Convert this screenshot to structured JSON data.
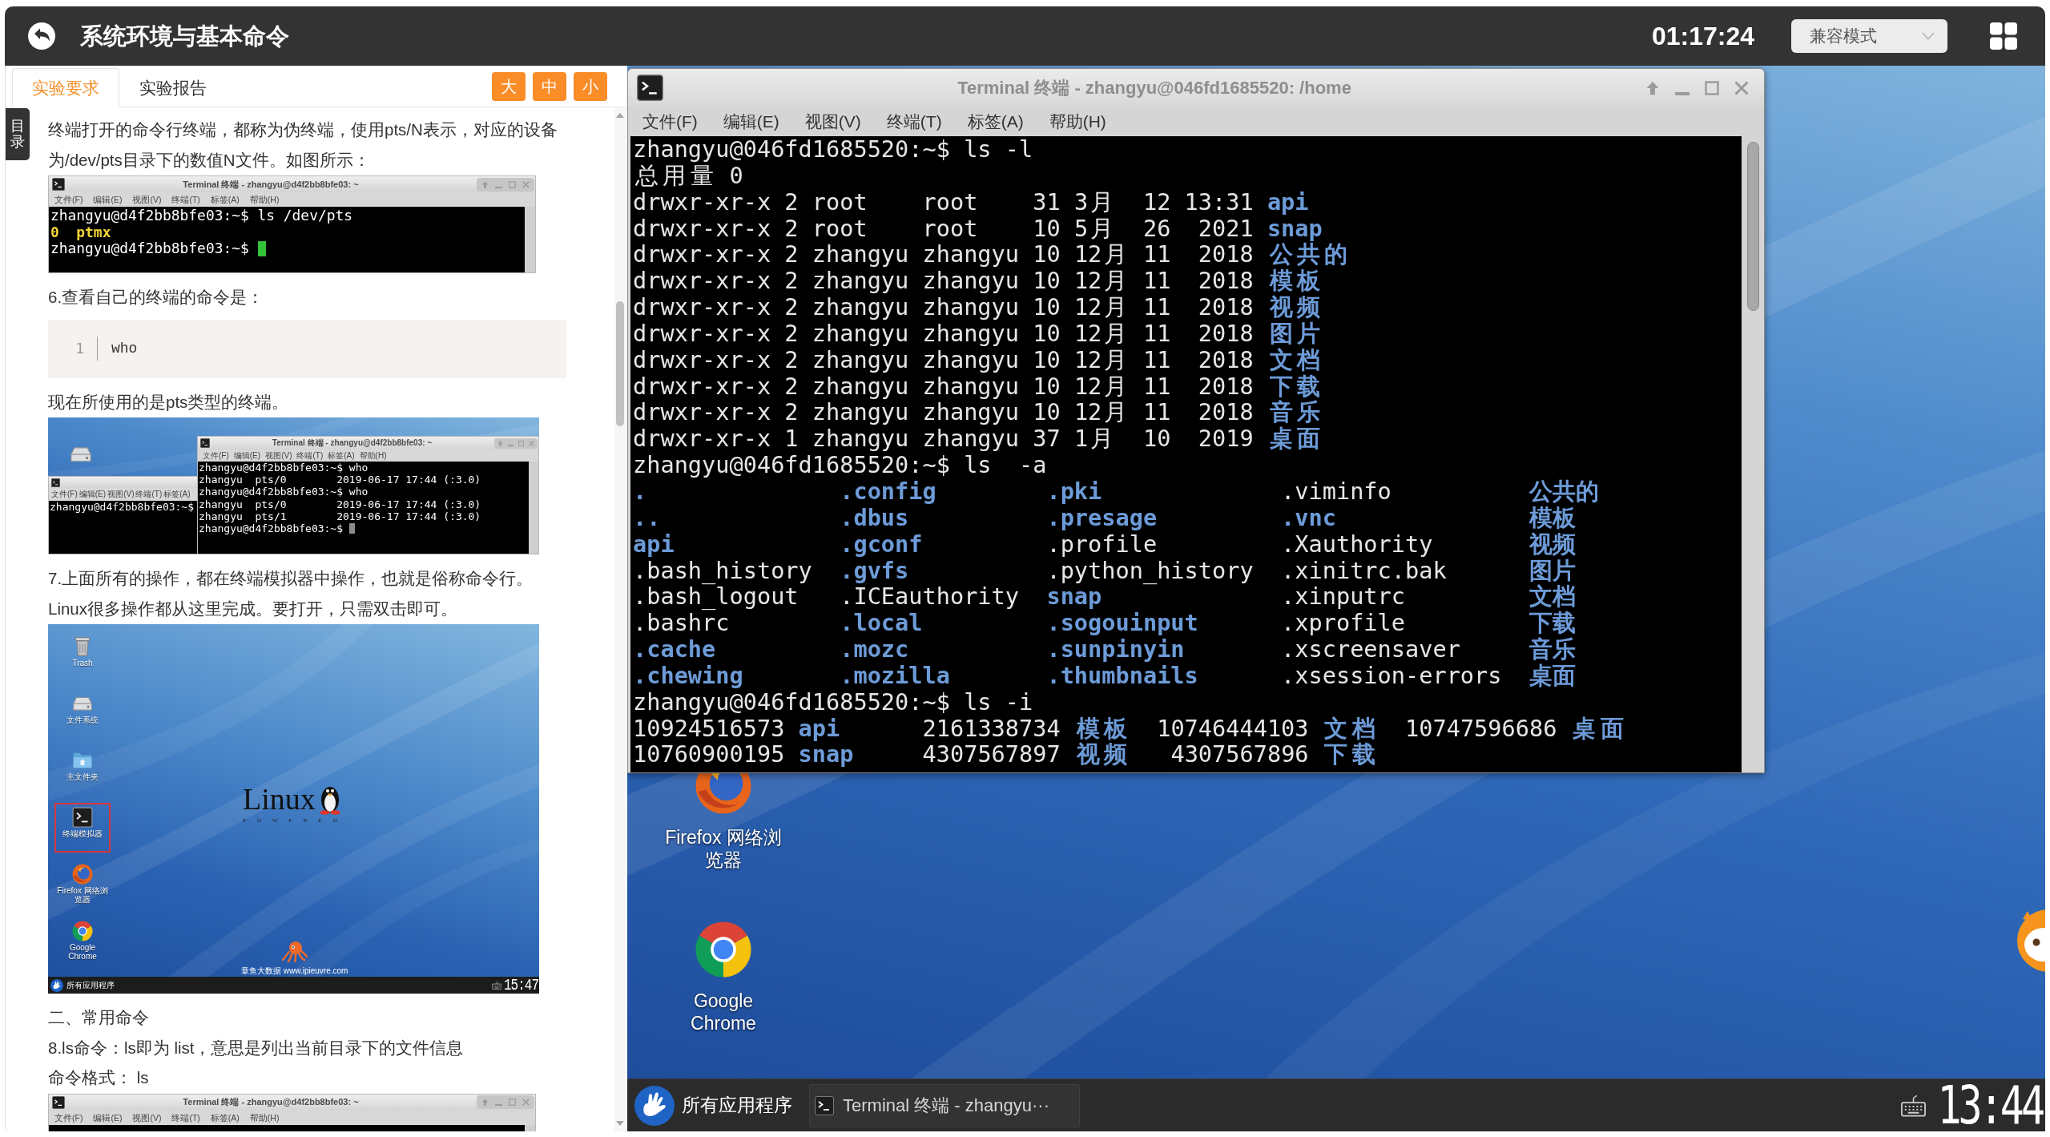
{
  "header": {
    "title": "系统环境与基本命令",
    "timer": "01:17:24",
    "mode_select": {
      "value": "兼容模式"
    }
  },
  "doc_panel": {
    "tabs": [
      {
        "label": "实验要求",
        "selected": true
      },
      {
        "label": "实验报告",
        "selected": false
      }
    ],
    "font_size_buttons": [
      "大",
      "中",
      "小"
    ],
    "toc_tab": "目录",
    "content": [
      {
        "kind": "paragraph",
        "text": "终端打开的命令行终端，都称为伪终端，使用pts/N表示，对应的设备为/dev/pts目录下的数值N文件。如图所示："
      },
      {
        "kind": "terminal_image",
        "window": {
          "title": "Terminal 终端 - zhangyu@d4f2bb8bfe03: ~",
          "menu": [
            "文件(F)",
            "编辑(E)",
            "视图(V)",
            "终端(T)",
            "标签(A)",
            "帮助(H)"
          ],
          "lines": [
            {
              "kind": "text",
              "text": "zhangyu@d4f2bb8bfe03:~$ ls /dev/pts"
            },
            {
              "kind": "highlight",
              "text": "0  ptmx"
            },
            {
              "kind": "text",
              "text": "zhangyu@d4f2bb8bfe03:~$ ",
              "cursor": true,
              "cursor_active": true
            }
          ]
        }
      },
      {
        "kind": "paragraph",
        "text": "6.查看自己的终端的命令是："
      },
      {
        "kind": "code",
        "lines": [
          {
            "number": "1",
            "code": "who"
          }
        ]
      },
      {
        "kind": "paragraph",
        "text": "现在所使用的是pts类型的终端。"
      },
      {
        "kind": "two_terminals_image",
        "back_window": {
          "menu": [
            "文件(F)",
            "编辑(E)",
            "视图(V)",
            "终端(T)",
            "标签(A)"
          ],
          "lines": [
            {
              "kind": "text",
              "text": "zhangyu@d4f2bb8bfe03:~$"
            }
          ]
        },
        "front_window": {
          "title": "Terminal 终端 - zhangyu@d4f2bb8bfe03: ~",
          "menu": [
            "文件(F)",
            "编辑(E)",
            "视图(V)",
            "终端(T)",
            "标签(A)",
            "帮助(H)"
          ],
          "lines": [
            {
              "kind": "text",
              "text": "zhangyu@d4f2bb8bfe03:~$ who"
            },
            {
              "kind": "text",
              "text": "zhangyu  pts/0        2019-06-17 17:44 (:3.0)"
            },
            {
              "kind": "text",
              "text": "zhangyu@d4f2bb8bfe03:~$ who"
            },
            {
              "kind": "text",
              "text": "zhangyu  pts/0        2019-06-17 17:44 (:3.0)"
            },
            {
              "kind": "text",
              "text": "zhangyu  pts/1        2019-06-17 17:44 (:3.0)"
            },
            {
              "kind": "text",
              "text": "zhangyu@d4f2bb8bfe03:~$ ",
              "cursor": true,
              "cursor_active": false
            }
          ]
        }
      },
      {
        "kind": "paragraph",
        "text": "7.上面所有的操作，都在终端模拟器中操作，也就是俗称命令行。Linux很多操作都从这里完成。要打开，只需双击即可。"
      },
      {
        "kind": "desktop_image",
        "icons": [
          {
            "kind": "trash",
            "label": "Trash",
            "highlighted": false
          },
          {
            "kind": "drive",
            "label": "文件系统",
            "highlighted": false
          },
          {
            "kind": "folder",
            "label": "主文件夹",
            "highlighted": false
          },
          {
            "kind": "terminal",
            "label": "终端模拟器",
            "highlighted": true
          },
          {
            "kind": "firefox",
            "label": "Firefox 网络浏览器",
            "highlighted": false
          },
          {
            "kind": "chrome",
            "label": "Google Chrome",
            "highlighted": false
          }
        ],
        "logo": {
          "text": "Linux",
          "tagline": "POWERED"
        },
        "wallpaper_caption": "章鱼大数据 www.ipieuvre.com",
        "taskbar": {
          "menu_label": "所有应用程序",
          "clock": "15:47"
        }
      },
      {
        "kind": "paragraph",
        "text": "二、常用命令"
      },
      {
        "kind": "paragraph",
        "text": "8.ls命令：ls即为 list，意思是列出当前目录下的文件信息"
      },
      {
        "kind": "paragraph",
        "text": "命令格式： ls"
      },
      {
        "kind": "terminal_image",
        "window": {
          "title": "Terminal 终端 - zhangyu@d4f2bb8bfe03: ~",
          "menu": [
            "文件(F)",
            "编辑(E)",
            "视图(V)",
            "终端(T)",
            "标签(A)",
            "帮助(H)"
          ]
        }
      }
    ]
  },
  "desktop": {
    "terminal_window": {
      "title": "Terminal 终端 - zhangyu@046fd1685520: /home",
      "menu": [
        "文件(F)",
        "编辑(E)",
        "视图(V)",
        "终端(T)",
        "标签(A)",
        "帮助(H)"
      ],
      "lines": [
        {
          "kind": "text",
          "text": "zhangyu@046fd1685520:~$ ls -l"
        },
        {
          "kind": "text",
          "text": "总用量 0"
        },
        {
          "kind": "text",
          "text": "drwxr-xr-x 2 root    root    31 3月  12 13:31 **api**"
        },
        {
          "kind": "text",
          "text": "drwxr-xr-x 2 root    root    10 5月  26  2021 **snap**"
        },
        {
          "kind": "text",
          "text": "drwxr-xr-x 2 zhangyu zhangyu 10 12月 11  2018 **公共的**"
        },
        {
          "kind": "text",
          "text": "drwxr-xr-x 2 zhangyu zhangyu 10 12月 11  2018 **模板**"
        },
        {
          "kind": "text",
          "text": "drwxr-xr-x 2 zhangyu zhangyu 10 12月 11  2018 **视频**"
        },
        {
          "kind": "text",
          "text": "drwxr-xr-x 2 zhangyu zhangyu 10 12月 11  2018 **图片**"
        },
        {
          "kind": "text",
          "text": "drwxr-xr-x 2 zhangyu zhangyu 10 12月 11  2018 **文档**"
        },
        {
          "kind": "text",
          "text": "drwxr-xr-x 2 zhangyu zhangyu 10 12月 11  2018 **下载**"
        },
        {
          "kind": "text",
          "text": "drwxr-xr-x 2 zhangyu zhangyu 10 12月 11  2018 **音乐**"
        },
        {
          "kind": "text",
          "text": "drwxr-xr-x 1 zhangyu zhangyu 37 1月  10  2019 **桌面**"
        },
        {
          "kind": "text",
          "text": "zhangyu@046fd1685520:~$ ls  -a"
        },
        {
          "kind": "columns",
          "rows": [
            [
              {
                "text": ".",
                "kind": "dir"
              },
              {
                "text": ".config",
                "kind": "dir"
              },
              {
                "text": ".pki",
                "kind": "dir"
              },
              {
                "text": ".viminfo",
                "kind": "file"
              },
              {
                "text": "公共的",
                "kind": "dir"
              }
            ],
            [
              {
                "text": "..",
                "kind": "dir"
              },
              {
                "text": ".dbus",
                "kind": "dir"
              },
              {
                "text": ".presage",
                "kind": "dir"
              },
              {
                "text": ".vnc",
                "kind": "dir"
              },
              {
                "text": "模板",
                "kind": "dir"
              }
            ],
            [
              {
                "text": "api",
                "kind": "dir"
              },
              {
                "text": ".gconf",
                "kind": "dir"
              },
              {
                "text": ".profile",
                "kind": "file"
              },
              {
                "text": ".Xauthority",
                "kind": "file"
              },
              {
                "text": "视频",
                "kind": "dir"
              }
            ],
            [
              {
                "text": ".bash_history",
                "kind": "file"
              },
              {
                "text": ".gvfs",
                "kind": "dir"
              },
              {
                "text": ".python_history",
                "kind": "file"
              },
              {
                "text": ".xinitrc.bak",
                "kind": "file"
              },
              {
                "text": "图片",
                "kind": "dir"
              }
            ],
            [
              {
                "text": ".bash_logout",
                "kind": "file"
              },
              {
                "text": ".ICEauthority",
                "kind": "file"
              },
              {
                "text": "snap",
                "kind": "dir"
              },
              {
                "text": ".xinputrc",
                "kind": "file"
              },
              {
                "text": "文档",
                "kind": "dir"
              }
            ],
            [
              {
                "text": ".bashrc",
                "kind": "file"
              },
              {
                "text": ".local",
                "kind": "dir"
              },
              {
                "text": ".sogouinput",
                "kind": "dir"
              },
              {
                "text": ".xprofile",
                "kind": "file"
              },
              {
                "text": "下载",
                "kind": "dir"
              }
            ],
            [
              {
                "text": ".cache",
                "kind": "dir"
              },
              {
                "text": ".mozc",
                "kind": "dir"
              },
              {
                "text": ".sunpinyin",
                "kind": "dir"
              },
              {
                "text": ".xscreensaver",
                "kind": "file"
              },
              {
                "text": "音乐",
                "kind": "dir"
              }
            ],
            [
              {
                "text": ".chewing",
                "kind": "dir"
              },
              {
                "text": ".mozilla",
                "kind": "dir"
              },
              {
                "text": ".thumbnails",
                "kind": "dir"
              },
              {
                "text": ".xsession-errors",
                "kind": "file"
              },
              {
                "text": "桌面",
                "kind": "dir"
              }
            ]
          ]
        },
        {
          "kind": "text",
          "text": "zhangyu@046fd1685520:~$ ls -i"
        },
        {
          "kind": "text",
          "text": "10924516573 **api**      2161338734 **模板**  10746444103 **文档**  10747596686 **桌面**"
        },
        {
          "kind": "text",
          "text": "10760900195 **snap**     4307567897 **视频**   4307567896 **下载**"
        }
      ]
    },
    "icons": [
      {
        "kind": "firefox",
        "label": "Firefox 网络浏览器"
      },
      {
        "kind": "chrome",
        "label": "Google Chrome"
      }
    ],
    "taskbar": {
      "menu_label": "所有应用程序",
      "tasks": [
        {
          "label": "Terminal 终端 - zhangyu···"
        }
      ],
      "clock": "13:44"
    }
  }
}
